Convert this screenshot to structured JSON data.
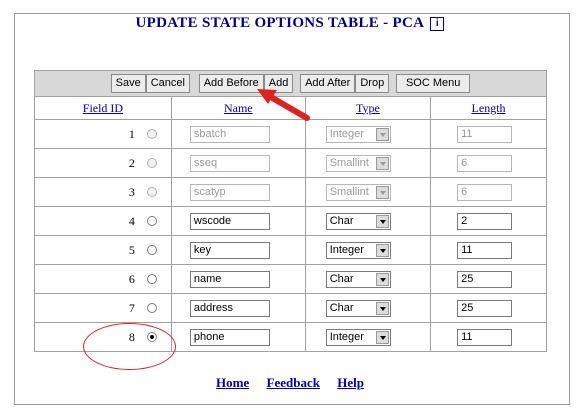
{
  "page": {
    "title": "UPDATE STATE OPTIONS TABLE - PCA",
    "info_icon": "i"
  },
  "toolbar": {
    "save": "Save",
    "cancel": "Cancel",
    "add_before": "Add Before",
    "add": "Add",
    "add_after": "Add After",
    "drop": "Drop",
    "soc_menu": "SOC Menu"
  },
  "headers": {
    "field_id": "Field ID",
    "name": "Name",
    "type": "Type",
    "length": "Length"
  },
  "rows": [
    {
      "id": "1",
      "name": "sbatch",
      "type": "Integer",
      "length": "11",
      "disabled": true
    },
    {
      "id": "2",
      "name": "sseq",
      "type": "Smallint",
      "length": "6",
      "disabled": true
    },
    {
      "id": "3",
      "name": "scatyp",
      "type": "Smallint",
      "length": "6",
      "disabled": true
    },
    {
      "id": "4",
      "name": "wscode",
      "type": "Char",
      "length": "2",
      "disabled": false
    },
    {
      "id": "5",
      "name": "key",
      "type": "Integer",
      "length": "11",
      "disabled": false
    },
    {
      "id": "6",
      "name": "name",
      "type": "Char",
      "length": "25",
      "disabled": false
    },
    {
      "id": "7",
      "name": "address",
      "type": "Char",
      "length": "25",
      "disabled": false
    },
    {
      "id": "8",
      "name": "phone",
      "type": "Integer",
      "length": "11",
      "disabled": false,
      "selected": true
    }
  ],
  "footer": {
    "home": "Home",
    "feedback": "Feedback",
    "help": "Help"
  },
  "colors": {
    "title": "#000080",
    "link": "#0000aa",
    "annotation": "#dd2222"
  }
}
